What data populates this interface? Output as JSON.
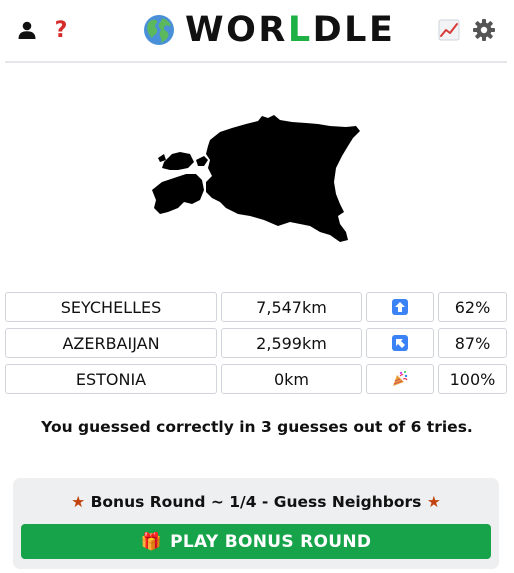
{
  "header": {
    "title_pre": "WOR",
    "title_hl": "L",
    "title_post": "DLE",
    "help_label": "?",
    "icons": {
      "profile": "user-icon",
      "help": "question-icon",
      "logo": "globe-icon",
      "stats": "chart-icon",
      "settings": "gear-icon"
    }
  },
  "country_shape": {
    "icon": "country-silhouette"
  },
  "guesses": [
    {
      "country": "SEYCHELLES",
      "distance": "7,547km",
      "direction_icon": "arrow-up-icon",
      "proximity": "62%"
    },
    {
      "country": "AZERBAIJAN",
      "distance": "2,599km",
      "direction_icon": "arrow-up-left-icon",
      "proximity": "87%"
    },
    {
      "country": "ESTONIA",
      "distance": "0km",
      "direction_icon": "party-popper-icon",
      "proximity": "100%"
    }
  ],
  "result_text": "You guessed correctly in 3 guesses out of 6 tries.",
  "bonus": {
    "title": "Bonus Round ~ 1/4 - Guess Neighbors",
    "star": "★",
    "play_label": "PLAY BONUS ROUND",
    "gift": "🎁"
  },
  "colors": {
    "accent_green": "#1fb046",
    "button_green": "#16a34a",
    "help_red": "#d62b2b",
    "star": "#c2410c",
    "arrow_blue": "#3b82f6"
  }
}
